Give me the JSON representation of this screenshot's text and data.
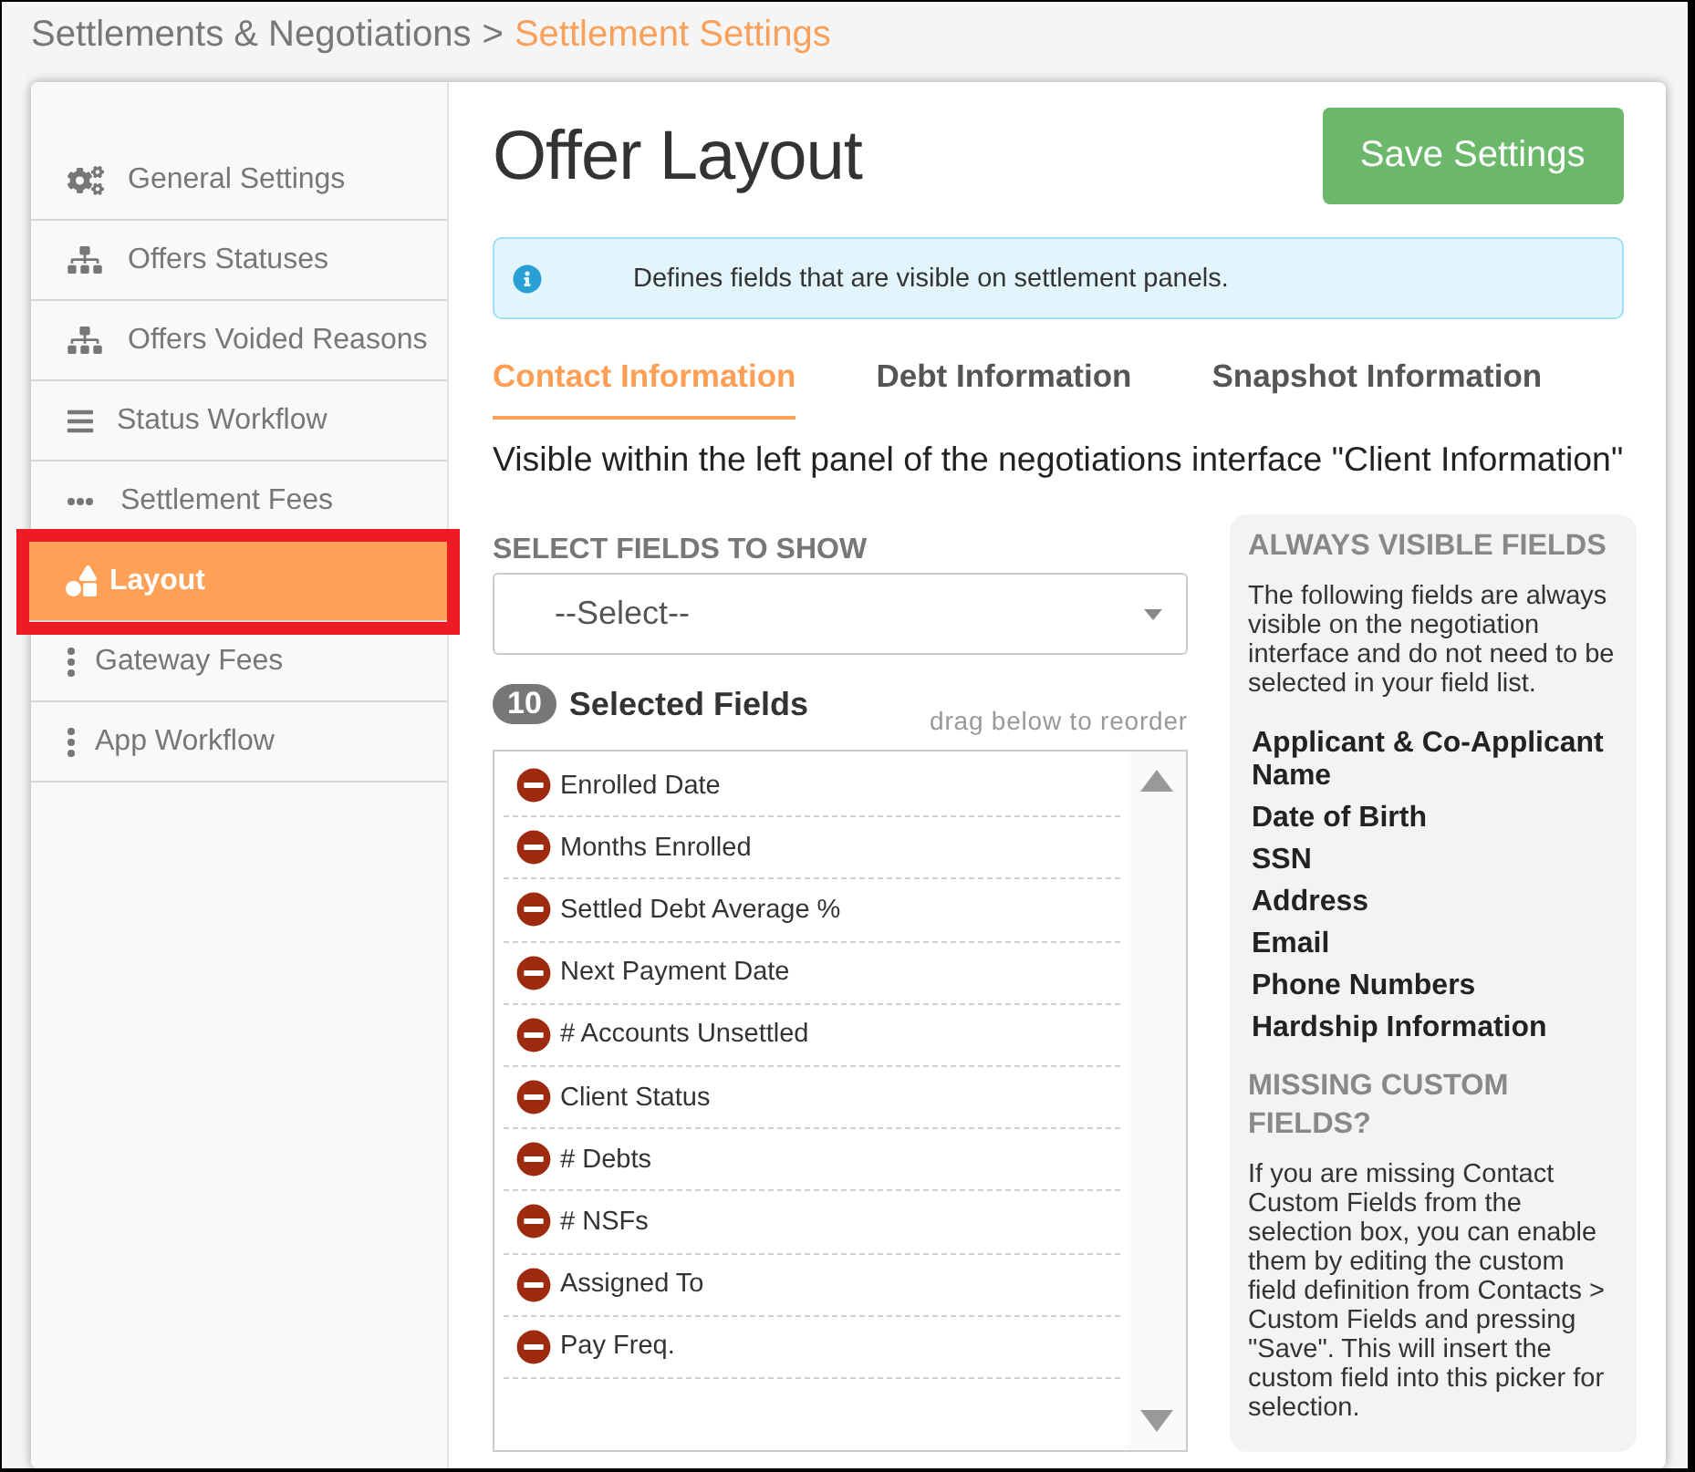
{
  "breadcrumb": {
    "parent": "Settlements & Negotiations",
    "separator": ">",
    "current": "Settlement Settings"
  },
  "sidebar": {
    "items": [
      {
        "label": "General Settings",
        "kind": "gears",
        "selected": false,
        "highlighted": false
      },
      {
        "label": "Offers Statuses",
        "kind": "sitemap",
        "selected": false,
        "highlighted": false
      },
      {
        "label": "Offers Voided Reasons",
        "kind": "sitemap",
        "selected": false,
        "highlighted": false
      },
      {
        "label": "Status Workflow",
        "kind": "bars",
        "selected": false,
        "highlighted": false
      },
      {
        "label": "Settlement Fees",
        "kind": "dots-horizontal",
        "selected": false,
        "highlighted": false
      },
      {
        "label": "Layout",
        "kind": "shapes",
        "selected": true,
        "highlighted": true
      },
      {
        "label": "Gateway Fees",
        "kind": "dots-vertical",
        "selected": false,
        "highlighted": false
      },
      {
        "label": "App Workflow",
        "kind": "dots-vertical",
        "selected": false,
        "highlighted": false
      }
    ]
  },
  "page": {
    "title": "Offer Layout",
    "save_button": "Save Settings"
  },
  "alert": {
    "kind": "info",
    "text": "Defines fields that are visible on settlement panels."
  },
  "tabs": [
    {
      "label": "Contact Information",
      "selected": true
    },
    {
      "label": "Debt Information",
      "selected": false
    },
    {
      "label": "Snapshot Information",
      "selected": false
    }
  ],
  "description": "Visible within the left panel of the negotiations interface \"Client Information\"",
  "field_picker": {
    "label": "SELECT FIELDS TO SHOW",
    "select": {
      "value": "--Select--"
    },
    "count": "10",
    "count_label": "Selected Fields",
    "hint": "drag below to reorder",
    "fields": [
      "Enrolled Date",
      "Months Enrolled",
      "Settled Debt Average %",
      "Next Payment Date",
      "# Accounts Unsettled",
      "Client Status",
      "# Debts",
      "# NSFs",
      "Assigned To",
      "Pay Freq."
    ]
  },
  "help_panel": {
    "heading": "ALWAYS VISIBLE FIELDS",
    "intro": "The following fields are always visible on the negotiation interface and do not need to be selected in your field list.",
    "always_visible": [
      "Applicant & Co-Applicant Name",
      "Date of Birth",
      "SSN",
      "Address",
      "Email",
      "Phone Numbers",
      "Hardship Information"
    ],
    "missing_heading": "MISSING CUSTOM FIELDS?",
    "missing_text": "If you are missing Contact Custom Fields from the selection box, you can enable them by editing the custom field definition from Contacts > Custom Fields and pressing \"Save\". This will insert the custom field into this picker for selection."
  }
}
